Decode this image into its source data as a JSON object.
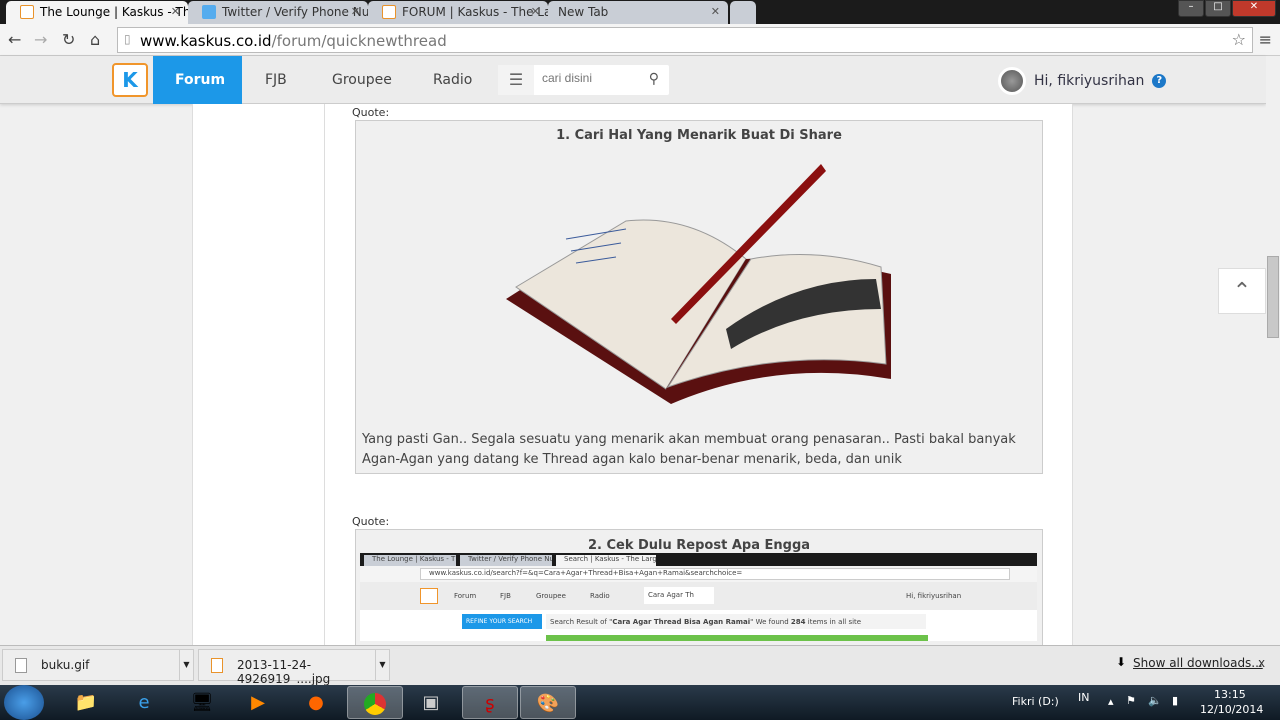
{
  "browser": {
    "tabs": [
      {
        "title": "The Lounge | Kaskus - The Lounge",
        "active": true
      },
      {
        "title": "Twitter / Verify Phone Number"
      },
      {
        "title": "FORUM | Kaskus - The Largest"
      },
      {
        "title": "New Tab"
      }
    ],
    "url_host": "www.kaskus.co.id",
    "url_path": "/forum/quicknewthread"
  },
  "site": {
    "logo": "K",
    "nav": [
      "Forum",
      "FJB",
      "Groupee",
      "Radio"
    ],
    "search_placeholder": "cari disini",
    "greeting": "Hi, fikriyusrihan",
    "help": "?"
  },
  "post": {
    "quote_label": "Quote:",
    "quote1": {
      "title": "1. Cari Hal Yang Menarik Buat Di Share",
      "text": "Yang pasti Gan.. Segala sesuatu yang menarik akan membuat orang penasaran.. Pasti bakal banyak Agan-Agan yang datang ke Thread agan kalo benar-benar menarik, beda, dan unik"
    },
    "quote2": {
      "title": "2. Cek Dulu Repost Apa Engga",
      "screenshot": {
        "tabs": [
          "The Lounge | Kaskus - The",
          "Twitter / Verify Phone Nu",
          "Search | Kaskus - The Larg"
        ],
        "url": "www.kaskus.co.id/search?f=&q=Cara+Agar+Thread+Bisa+Agan+Ramai&searchchoice=",
        "nav": [
          "Forum",
          "FJB",
          "Groupee",
          "Radio"
        ],
        "search_value": "Cara Agar Th",
        "greeting": "Hi, fikriyusrihan",
        "refine": "REFINE YOUR SEARCH",
        "result_prefix": "Search Result of \"",
        "result_query": "Cara Agar Thread Bisa Agan Ramai",
        "result_mid": "\" We found ",
        "result_count": "284",
        "result_suffix": " items in all site"
      }
    }
  },
  "downloads": {
    "items": [
      "buku.gif",
      "2013-11-24-4926919_....jpg"
    ],
    "show_all": "Show all downloads...",
    "close": "x"
  },
  "taskbar": {
    "drive": "Fikri (D:)",
    "lang": "IN",
    "time": "13:15",
    "date": "12/10/2014"
  }
}
